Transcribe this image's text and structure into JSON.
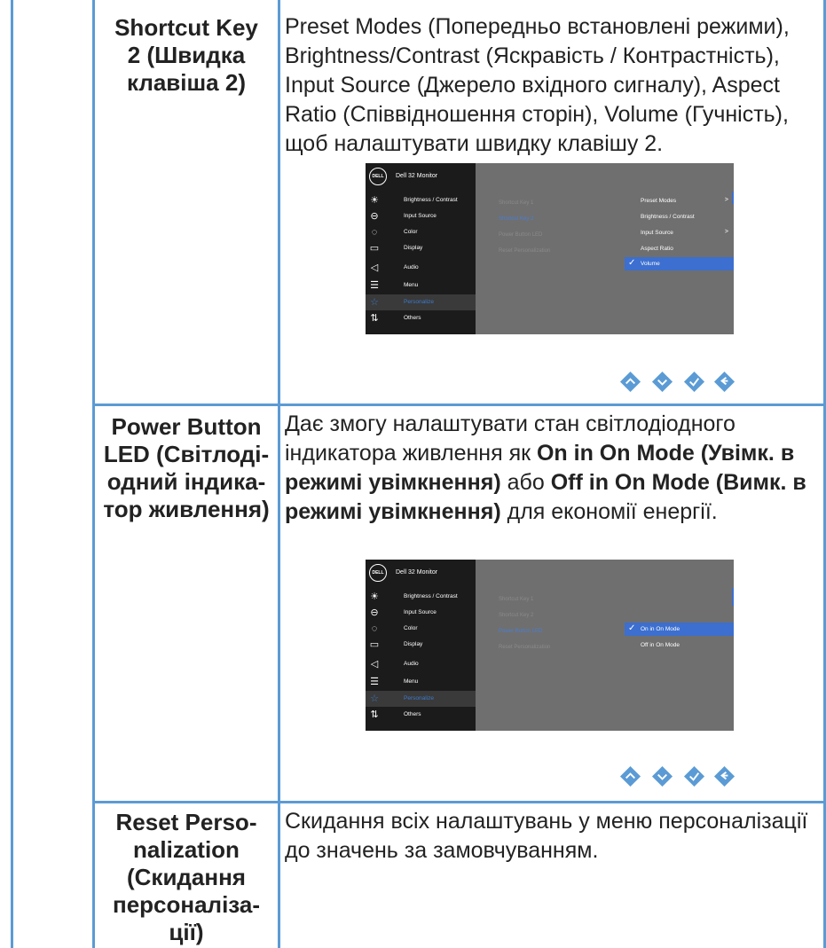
{
  "rows": [
    {
      "label": "Shortcut Key 2 (Швидка клавіша 2)",
      "label_lines": [
        "Shortcut Key",
        "2 (Швидка",
        "клавіша 2)"
      ],
      "desc": "Preset Modes (Попередньо встановлені режими), Brightness/Contrast (Яскравість / Контрастність), Input Source (Джерело вхідного сигналу), Aspect Ratio (Співвідношення сторін), Volume (Гучність), щоб налаштувати швидку клавішу 2."
    },
    {
      "label": "Power Button LED (Світлодіодний індикатор живлення)",
      "label_lines": [
        "Power Button",
        "LED (Світлоді-",
        "одний індика-",
        "тор живлення)"
      ],
      "desc_parts": {
        "p1": "Дає змогу налаштувати стан світлодіодного індикатора живлення як ",
        "b1": "On in On Mode (Увімк. в режимі увімкнення)",
        "p2": " або ",
        "b2": "Off in On Mode (Вимк. в режимі увімкнення)",
        "p3": " для економії енергії."
      }
    },
    {
      "label": "Reset Personalization (Скидання персоналізації)",
      "label_lines": [
        "Reset Perso-",
        "nalization",
        "(Скидання",
        "персоналіза-",
        "ції)"
      ],
      "desc": "Скидання всіх налаштувань у меню персоналізації до значень за замовчуванням."
    }
  ],
  "osd": {
    "logo": "DELL",
    "title": "Dell 32 Monitor",
    "menu": [
      {
        "label": "Brightness / Contrast",
        "icon": "brightness-icon"
      },
      {
        "label": "Input Source",
        "icon": "input-source-icon"
      },
      {
        "label": "Color",
        "icon": "color-icon"
      },
      {
        "label": "Display",
        "icon": "display-icon"
      },
      {
        "label": "Audio",
        "icon": "audio-icon"
      },
      {
        "label": "Menu",
        "icon": "menu-icon"
      },
      {
        "label": "Personalize",
        "icon": "star-icon"
      },
      {
        "label": "Others",
        "icon": "others-icon"
      }
    ],
    "submenu": [
      "Shortcut Key 1",
      "Shortcut Key 2",
      "Power Button LED",
      "Reset Personalization"
    ],
    "shot1_options": [
      "Preset Modes",
      "Brightness / Contrast",
      "Input Source",
      "Aspect Ratio",
      "Volume"
    ],
    "shot2_options": [
      "On in On Mode",
      "Off in On Mode"
    ],
    "nav_buttons": [
      "up-icon",
      "down-icon",
      "confirm-icon",
      "back-icon"
    ]
  },
  "colors": {
    "border": "#5b9bd5",
    "osd_highlight": "#3c6fcf",
    "osd_dark": "#1b1b1b",
    "osd_gray": "#6f6f6f"
  }
}
